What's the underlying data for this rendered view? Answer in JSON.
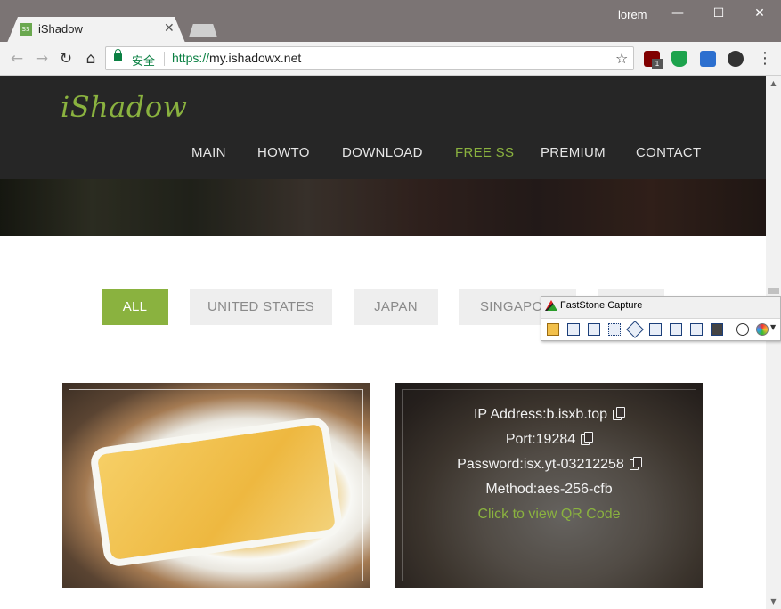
{
  "browser": {
    "tab_title": "iShadow",
    "tab_favicon_text": "SS",
    "profile_name": "lorem",
    "window_controls": {
      "minimize": "—",
      "maximize": "☐",
      "close": "✕"
    },
    "security_label": "安全",
    "url_scheme": "https://",
    "url_host": "my.ishadowx.net",
    "nav_icons": {
      "back": "←",
      "forward": "→",
      "reload": "↻",
      "home": "⌂",
      "star": "☆",
      "menu": "⋮"
    },
    "extension_badge": "1"
  },
  "site": {
    "logo": "iShadow",
    "nav": [
      "MAIN",
      "HOWTO",
      "DOWNLOAD",
      "FREE SS",
      "PREMIUM",
      "CONTACT"
    ],
    "active_nav": "FREE SS",
    "filters": [
      "ALL",
      "UNITED STATES",
      "JAPAN",
      "SINGAPO"
    ],
    "active_filter": "ALL",
    "server": {
      "ip": "IP Address:b.isxb.top",
      "port": "Port:19284",
      "password": "Password:isx.yt-03212258",
      "method": "Method:aes-256-cfb",
      "qr_link": "Click to view QR Code"
    }
  },
  "faststone": {
    "title": "FastStone Capture",
    "tools": [
      "open-icon",
      "window-icon",
      "object-icon",
      "rectangle-icon",
      "freehand-icon",
      "fullscreen-icon",
      "scrolling-icon",
      "fixed-region-icon",
      "video-icon",
      "timer-icon",
      "paint-icon"
    ]
  },
  "colors": {
    "accent": "#8ab23f",
    "header_bg": "#262626",
    "titlebar": "#7b7474"
  }
}
